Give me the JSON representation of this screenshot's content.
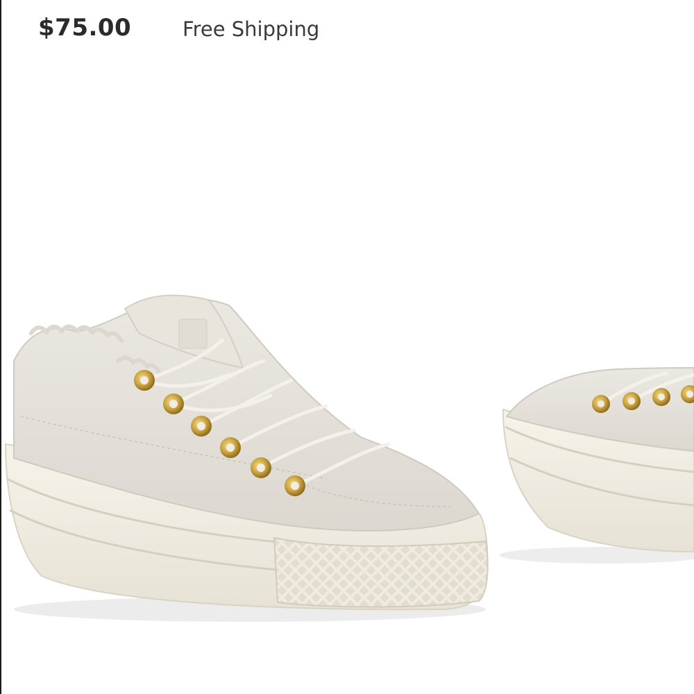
{
  "listing": {
    "price": "$75.00",
    "shipping": "Free Shipping"
  },
  "photo": {
    "subject": "sneaker-pair",
    "colors": {
      "upper": "#e4e0d9",
      "sole": "#f0ece0",
      "eyelet": "#c9a23e",
      "lace": "#f4f1ea"
    }
  }
}
